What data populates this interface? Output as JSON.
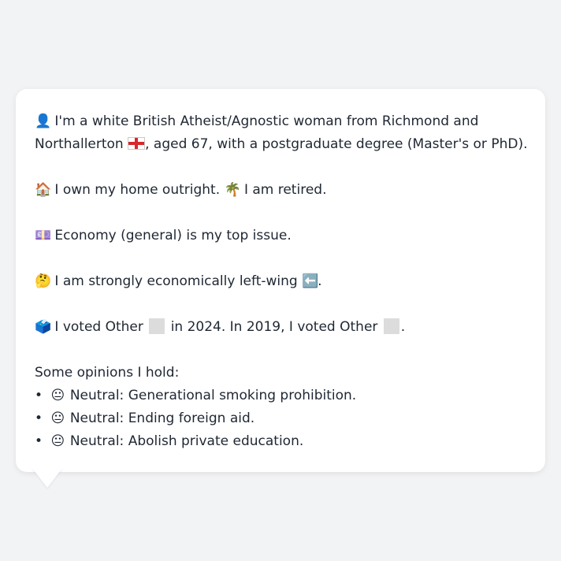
{
  "profile": {
    "intro_emoji": "👤",
    "intro_text_1": "I'm a white British Atheist/Agnostic woman from Richmond and",
    "intro_text_2a": "Northallerton",
    "intro_text_2b": ", aged 67, with a postgraduate degree (Master's or PhD).",
    "home_emoji": "🏠",
    "home_text": "I own my home outright.",
    "retired_emoji": "🌴",
    "retired_text": "I am retired.",
    "issue_emoji": "💷",
    "issue_text": "Economy (general) is my top issue.",
    "econ_emoji": "🤔",
    "econ_text": "I am strongly economically left-wing",
    "econ_arrow": "⬅️",
    "econ_end": ".",
    "vote_emoji": "🗳️",
    "vote_text_1": "I voted Other",
    "vote_text_2": "in 2024. In 2019, I voted Other",
    "vote_end": "."
  },
  "opinions": {
    "heading": "Some opinions I hold:",
    "bullet": "•",
    "items": [
      {
        "emoji": "😐",
        "text": "Neutral: Generational smoking prohibition."
      },
      {
        "emoji": "😐",
        "text": "Neutral: Ending foreign aid."
      },
      {
        "emoji": "😐",
        "text": "Neutral: Abolish private education."
      }
    ]
  }
}
